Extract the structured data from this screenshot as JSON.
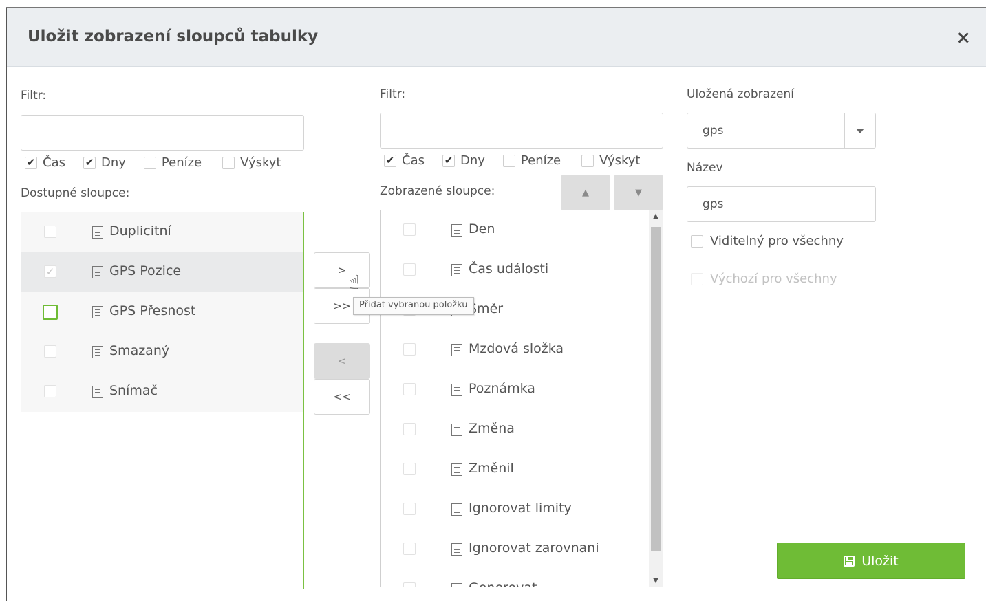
{
  "dialog": {
    "title": "Uložit zobrazení sloupců tabulky",
    "close_icon": "×"
  },
  "left": {
    "filter_label": "Filtr:",
    "filter_value": "",
    "type_filters": [
      {
        "label": "Čas",
        "checked": true
      },
      {
        "label": "Dny",
        "checked": true
      },
      {
        "label": "Peníze",
        "checked": false
      },
      {
        "label": "Výskyt",
        "checked": false
      }
    ],
    "list_label": "Dostupné sloupce:",
    "items": [
      {
        "label": "Duplicitní",
        "checked": false
      },
      {
        "label": "GPS Pozice",
        "checked": true,
        "selected": true
      },
      {
        "label": "GPS Přesnost",
        "checked": false,
        "focused": true
      },
      {
        "label": "Smazaný",
        "checked": false
      },
      {
        "label": "Snímač",
        "checked": false
      }
    ]
  },
  "move_buttons": {
    "add_one": ">",
    "add_all": ">>",
    "remove_one": "<",
    "remove_all": "<<"
  },
  "tooltip": {
    "text": "Přidat vybranou položku"
  },
  "right": {
    "filter_label": "Filtr:",
    "filter_value": "",
    "type_filters": [
      {
        "label": "Čas",
        "checked": true
      },
      {
        "label": "Dny",
        "checked": true
      },
      {
        "label": "Peníze",
        "checked": false
      },
      {
        "label": "Výskyt",
        "checked": false
      }
    ],
    "list_label": "Zobrazené sloupce:",
    "move_up_icon": "▲",
    "move_down_icon": "▼",
    "items": [
      {
        "label": "Den"
      },
      {
        "label": "Čas události"
      },
      {
        "label": "Směr"
      },
      {
        "label": "Mzdová složka"
      },
      {
        "label": "Poznámka"
      },
      {
        "label": "Změna"
      },
      {
        "label": "Změnil"
      },
      {
        "label": "Ignorovat limity"
      },
      {
        "label": "Ignorovat zarovnani"
      },
      {
        "label": "Generovat"
      }
    ]
  },
  "saved": {
    "saved_views_label": "Uložená zobrazení",
    "saved_views_value": "gps",
    "name_label": "Název",
    "name_value": "gps",
    "visible_for_all": "Viditelný pro všechny",
    "default_for_all": "Výchozí pro všechny",
    "save_label": "Uložit"
  },
  "colors": {
    "accent_green": "#6fbc36",
    "header_bg": "#ebeef1"
  }
}
